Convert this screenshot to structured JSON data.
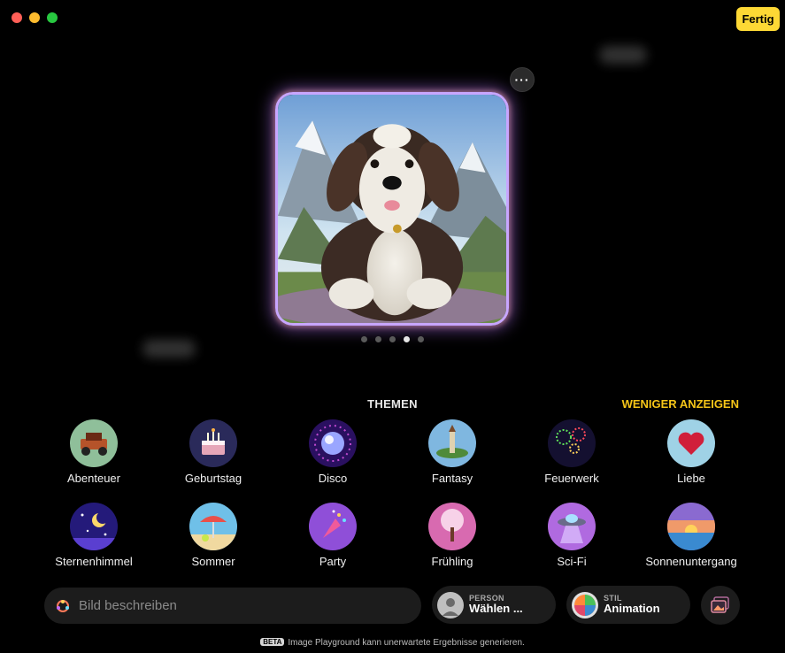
{
  "window": {
    "done_label": "Fertig",
    "more_label": "···"
  },
  "colors": {
    "accent": "#f5c518",
    "done_button": "#fdd835",
    "panel": "#1c1c1c"
  },
  "carousel": {
    "count": 5,
    "active_index": 3
  },
  "themes": {
    "title": "THEMEN",
    "show_less": "WENIGER ANZEIGEN",
    "items": [
      {
        "label": "Abenteuer",
        "icon": "jeep-icon"
      },
      {
        "label": "Geburtstag",
        "icon": "birthday-cake-icon"
      },
      {
        "label": "Disco",
        "icon": "disco-ball-icon"
      },
      {
        "label": "Fantasy",
        "icon": "castle-island-icon"
      },
      {
        "label": "Feuerwerk",
        "icon": "fireworks-icon"
      },
      {
        "label": "Liebe",
        "icon": "heart-icon"
      },
      {
        "label": "Sternenhimmel",
        "icon": "moon-stars-icon"
      },
      {
        "label": "Sommer",
        "icon": "beach-umbrella-icon"
      },
      {
        "label": "Party",
        "icon": "party-popper-icon"
      },
      {
        "label": "Frühling",
        "icon": "blossom-tree-icon"
      },
      {
        "label": "Sci-Fi",
        "icon": "ufo-icon"
      },
      {
        "label": "Sonnenuntergang",
        "icon": "sunset-icon"
      }
    ]
  },
  "prompt": {
    "placeholder": "Bild beschreiben"
  },
  "person": {
    "caption": "PERSON",
    "value": "Wählen ..."
  },
  "style": {
    "caption": "STIL",
    "value": "Animation"
  },
  "footer": {
    "badge": "BETA",
    "text": "Image Playground kann unerwartete Ergebnisse generieren."
  }
}
